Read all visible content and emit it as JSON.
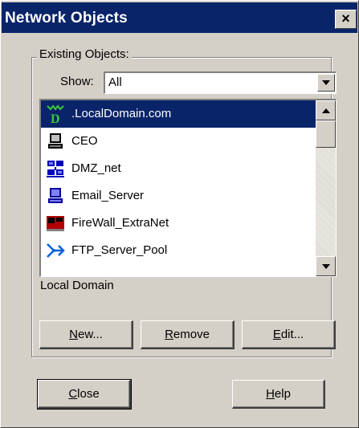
{
  "window": {
    "title": "Network Objects",
    "close_glyph": "×"
  },
  "group": {
    "legend": "Existing Objects:"
  },
  "filter": {
    "label": "Show:",
    "value": "All"
  },
  "list": {
    "items": [
      {
        "label": ".LocalDomain.com",
        "icon": "domain-icon",
        "selected": true
      },
      {
        "label": "CEO",
        "icon": "workstation-icon"
      },
      {
        "label": "DMZ_net",
        "icon": "network-icon"
      },
      {
        "label": "Email_Server",
        "icon": "workstation-icon"
      },
      {
        "label": "FireWall_ExtraNet",
        "icon": "firewall-icon"
      },
      {
        "label": "FTP_Server_Pool",
        "icon": "server-pool-icon"
      }
    ]
  },
  "description": "Local Domain",
  "buttons": {
    "new": {
      "accel": "N",
      "rest": "ew..."
    },
    "remove": {
      "accel": "R",
      "rest": "emove"
    },
    "edit": {
      "accel": "E",
      "rest": "dit..."
    },
    "close": {
      "accel": "C",
      "rest": "lose"
    },
    "help": {
      "accel": "H",
      "rest": "elp"
    }
  },
  "colors": {
    "selection": "#0a246a",
    "face": "#d4d0c8",
    "titlebar": "#0a246a"
  }
}
